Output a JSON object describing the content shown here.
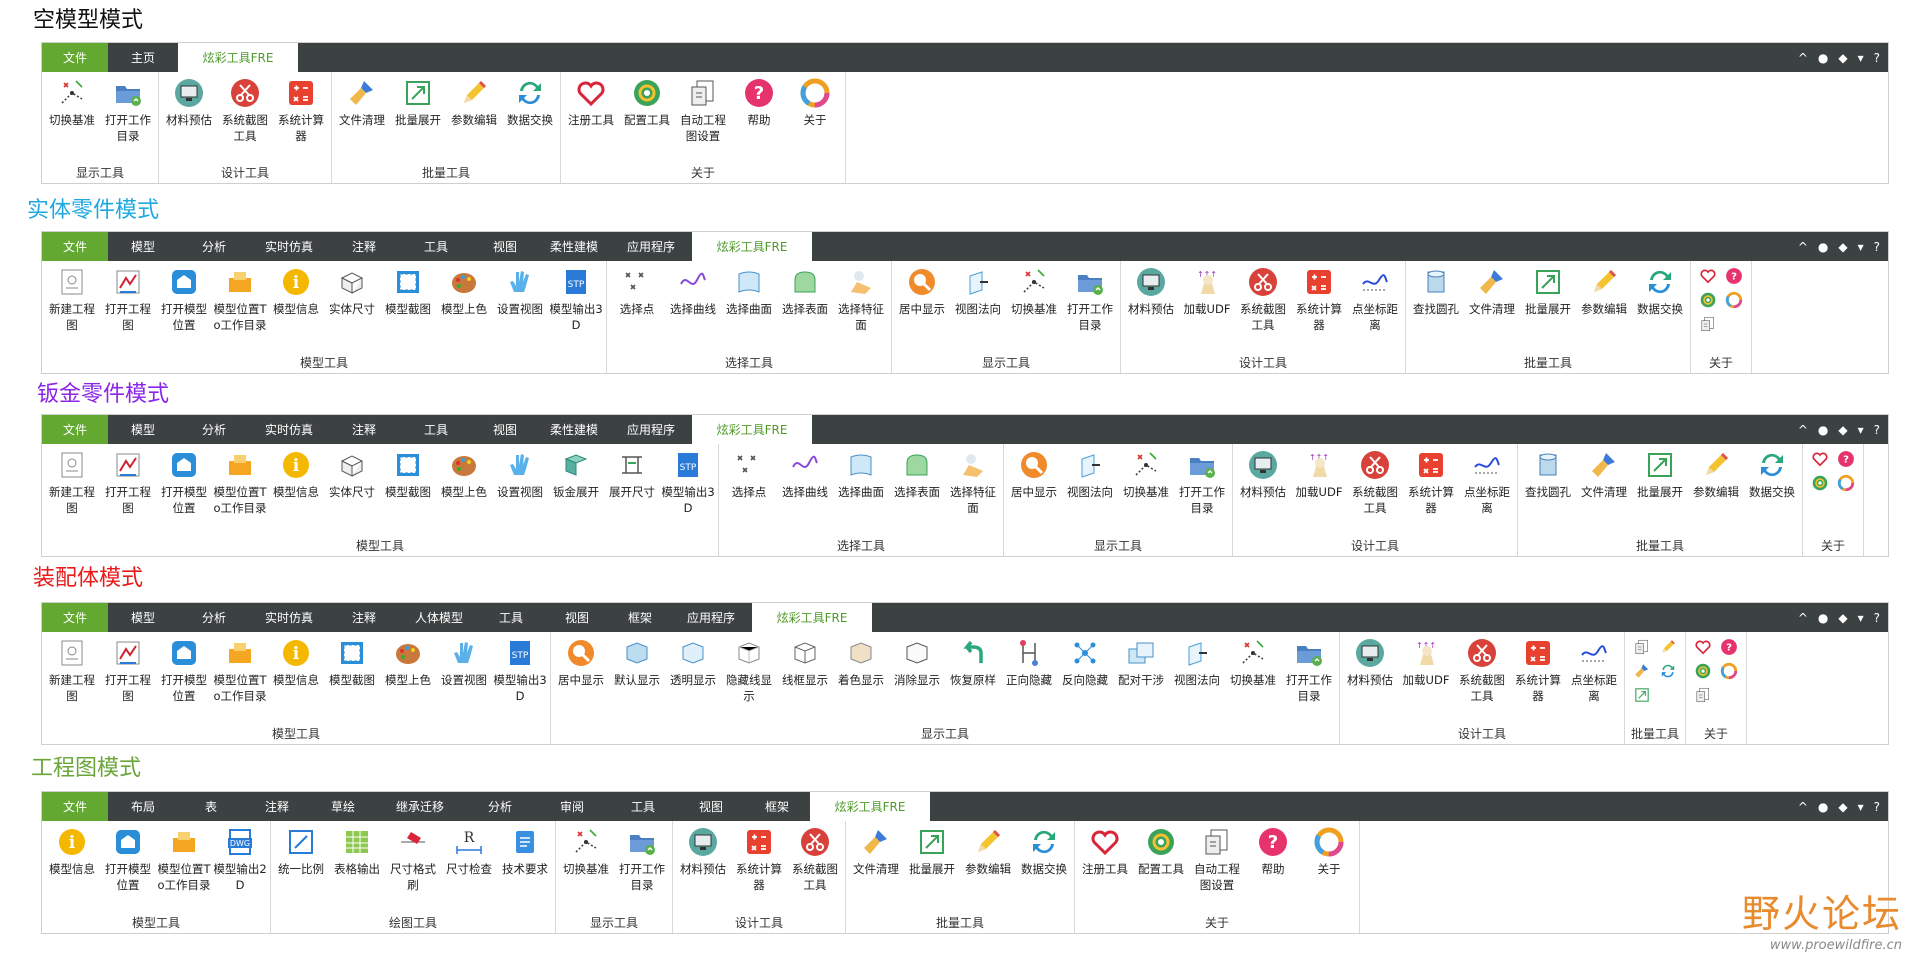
{
  "colors": {
    "file_tab": "#63a831",
    "tabbar": "#3c4142",
    "active_tab_text": "#4f9a2a",
    "title_cyan": "#1ea8e0",
    "title_purple": "#8b25e8",
    "title_red": "#e81a1a",
    "title_green": "#6aa53a"
  },
  "tb_right": {
    "up": "^",
    "user": "●",
    "cap": "◆",
    "down": "▾",
    "help": "?"
  },
  "s1": {
    "title": "空模型模式",
    "tabs": [
      "文件",
      "主页",
      "炫彩工具FRE"
    ],
    "groups": [
      {
        "label": "显示工具",
        "tools": [
          {
            "label": "切换基准",
            "icon": "axis"
          },
          {
            "label": "打开工作目录",
            "icon": "folder"
          }
        ]
      },
      {
        "label": "设计工具",
        "tools": [
          {
            "label": "材料预估",
            "icon": "monitor"
          },
          {
            "label": "系统截图工具",
            "icon": "scissors"
          },
          {
            "label": "系统计算器",
            "icon": "calc"
          }
        ]
      },
      {
        "label": "批量工具",
        "tools": [
          {
            "label": "文件清理",
            "icon": "brush"
          },
          {
            "label": "批量展开",
            "icon": "expand"
          },
          {
            "label": "参数编辑",
            "icon": "pencil"
          },
          {
            "label": "数据交换",
            "icon": "exchange"
          }
        ]
      },
      {
        "label": "关于",
        "tools": [
          {
            "label": "注册工具",
            "icon": "heart"
          },
          {
            "label": "配置工具",
            "icon": "gear"
          },
          {
            "label": "自动工程图设置",
            "icon": "drawing"
          },
          {
            "label": "帮助",
            "icon": "help"
          },
          {
            "label": "关于",
            "icon": "about"
          }
        ]
      }
    ]
  },
  "s2": {
    "title": "实体零件模式",
    "tabs": [
      "文件",
      "模型",
      "分析",
      "实时仿真",
      "注释",
      "工具",
      "视图",
      "柔性建模",
      "应用程序",
      "炫彩工具FRE"
    ],
    "groups": [
      {
        "label": "模型工具",
        "tools": [
          {
            "label": "新建工程图",
            "icon": "newdraw"
          },
          {
            "label": "打开工程图",
            "icon": "opendraw"
          },
          {
            "label": "打开模型位置",
            "icon": "openloc"
          },
          {
            "label": "模型位置To工作目录",
            "icon": "locto"
          },
          {
            "label": "模型信息",
            "icon": "info"
          },
          {
            "label": "实体尺寸",
            "icon": "box"
          },
          {
            "label": "模型截图",
            "icon": "shot"
          },
          {
            "label": "模型上色",
            "icon": "palette"
          },
          {
            "label": "设置视图",
            "icon": "hand"
          },
          {
            "label": "模型输出3D",
            "icon": "stp"
          }
        ]
      },
      {
        "label": "选择工具",
        "tools": [
          {
            "label": "选择点",
            "icon": "points"
          },
          {
            "label": "选择曲线",
            "icon": "curve"
          },
          {
            "label": "选择曲面",
            "icon": "surface"
          },
          {
            "label": "选择表面",
            "icon": "face"
          },
          {
            "label": "选择特征面",
            "icon": "feature"
          }
        ]
      },
      {
        "label": "显示工具",
        "tools": [
          {
            "label": "居中显示",
            "icon": "center"
          },
          {
            "label": "视图法向",
            "icon": "normal"
          },
          {
            "label": "切换基准",
            "icon": "axis"
          },
          {
            "label": "打开工作目录",
            "icon": "folder"
          }
        ]
      },
      {
        "label": "设计工具",
        "tools": [
          {
            "label": "材料预估",
            "icon": "monitor"
          },
          {
            "label": "加载UDF",
            "icon": "udf"
          },
          {
            "label": "系统截图工具",
            "icon": "scissors"
          },
          {
            "label": "系统计算器",
            "icon": "calc"
          },
          {
            "label": "点坐标距离",
            "icon": "ptdist"
          }
        ]
      },
      {
        "label": "批量工具",
        "tools": [
          {
            "label": "查找圆孔",
            "icon": "hole"
          },
          {
            "label": "文件清理",
            "icon": "brush"
          },
          {
            "label": "批量展开",
            "icon": "expand"
          },
          {
            "label": "参数编辑",
            "icon": "pencil"
          },
          {
            "label": "数据交换",
            "icon": "exchange"
          }
        ]
      }
    ],
    "about_label": "关于"
  },
  "s3": {
    "title": "钣金零件模式",
    "tabs": [
      "文件",
      "模型",
      "分析",
      "实时仿真",
      "注释",
      "工具",
      "视图",
      "柔性建模",
      "应用程序",
      "炫彩工具FRE"
    ],
    "groups": [
      {
        "label": "模型工具",
        "tools": [
          {
            "label": "新建工程图",
            "icon": "newdraw"
          },
          {
            "label": "打开工程图",
            "icon": "opendraw"
          },
          {
            "label": "打开模型位置",
            "icon": "openloc"
          },
          {
            "label": "模型位置To工作目录",
            "icon": "locto"
          },
          {
            "label": "模型信息",
            "icon": "info"
          },
          {
            "label": "实体尺寸",
            "icon": "box"
          },
          {
            "label": "模型截图",
            "icon": "shot"
          },
          {
            "label": "模型上色",
            "icon": "palette"
          },
          {
            "label": "设置视图",
            "icon": "hand"
          },
          {
            "label": "钣金展开",
            "icon": "sheet"
          },
          {
            "label": "展开尺寸",
            "icon": "unfold"
          },
          {
            "label": "模型输出3D",
            "icon": "stp"
          }
        ]
      },
      {
        "label": "选择工具",
        "tools": [
          {
            "label": "选择点",
            "icon": "points"
          },
          {
            "label": "选择曲线",
            "icon": "curve"
          },
          {
            "label": "选择曲面",
            "icon": "surface"
          },
          {
            "label": "选择表面",
            "icon": "face"
          },
          {
            "label": "选择特征面",
            "icon": "feature"
          }
        ]
      },
      {
        "label": "显示工具",
        "tools": [
          {
            "label": "居中显示",
            "icon": "center"
          },
          {
            "label": "视图法向",
            "icon": "normal"
          },
          {
            "label": "切换基准",
            "icon": "axis"
          },
          {
            "label": "打开工作目录",
            "icon": "folder"
          }
        ]
      },
      {
        "label": "设计工具",
        "tools": [
          {
            "label": "材料预估",
            "icon": "monitor"
          },
          {
            "label": "加载UDF",
            "icon": "udf"
          },
          {
            "label": "系统截图工具",
            "icon": "scissors"
          },
          {
            "label": "系统计算器",
            "icon": "calc"
          },
          {
            "label": "点坐标距离",
            "icon": "ptdist"
          }
        ]
      },
      {
        "label": "批量工具",
        "tools": [
          {
            "label": "查找圆孔",
            "icon": "hole"
          },
          {
            "label": "文件清理",
            "icon": "brush"
          },
          {
            "label": "批量展开",
            "icon": "expand"
          },
          {
            "label": "参数编辑",
            "icon": "pencil"
          },
          {
            "label": "数据交换",
            "icon": "exchange"
          }
        ]
      }
    ],
    "about_label": "关于"
  },
  "s4": {
    "title": "装配体模式",
    "tabs": [
      "文件",
      "模型",
      "分析",
      "实时仿真",
      "注释",
      "人体模型",
      "工具",
      "视图",
      "框架",
      "应用程序",
      "炫彩工具FRE"
    ],
    "groups": [
      {
        "label": "模型工具",
        "tools": [
          {
            "label": "新建工程图",
            "icon": "newdraw"
          },
          {
            "label": "打开工程图",
            "icon": "opendraw"
          },
          {
            "label": "打开模型位置",
            "icon": "openloc"
          },
          {
            "label": "模型位置To工作目录",
            "icon": "locto"
          },
          {
            "label": "模型信息",
            "icon": "info"
          },
          {
            "label": "模型截图",
            "icon": "shot"
          },
          {
            "label": "模型上色",
            "icon": "palette"
          },
          {
            "label": "设置视图",
            "icon": "hand"
          },
          {
            "label": "模型输出3D",
            "icon": "stp"
          }
        ]
      },
      {
        "label": "显示工具",
        "tools": [
          {
            "label": "居中显示",
            "icon": "center"
          },
          {
            "label": "默认显示",
            "icon": "cube1"
          },
          {
            "label": "透明显示",
            "icon": "cube2"
          },
          {
            "label": "隐藏线显示",
            "icon": "cube3"
          },
          {
            "label": "线框显示",
            "icon": "cube4"
          },
          {
            "label": "着色显示",
            "icon": "cube5"
          },
          {
            "label": "消除显示",
            "icon": "cube6"
          },
          {
            "label": "恢复原样",
            "icon": "undo"
          },
          {
            "label": "正向隐藏",
            "icon": "hide"
          },
          {
            "label": "反向隐藏",
            "icon": "rhide"
          },
          {
            "label": "配对干涉",
            "icon": "interf"
          },
          {
            "label": "视图法向",
            "icon": "normal"
          },
          {
            "label": "切换基准",
            "icon": "axis"
          },
          {
            "label": "打开工作目录",
            "icon": "folder"
          }
        ]
      },
      {
        "label": "设计工具",
        "tools": [
          {
            "label": "材料预估",
            "icon": "monitor"
          },
          {
            "label": "加载UDF",
            "icon": "udf"
          },
          {
            "label": "系统截图工具",
            "icon": "scissors"
          },
          {
            "label": "系统计算器",
            "icon": "calc"
          },
          {
            "label": "点坐标距离",
            "icon": "ptdist"
          }
        ]
      }
    ],
    "batch_label": "批量工具",
    "about_label": "关于"
  },
  "s5": {
    "title": "工程图模式",
    "tabs": [
      "文件",
      "布局",
      "表",
      "注释",
      "草绘",
      "继承迁移",
      "分析",
      "审阅",
      "工具",
      "视图",
      "框架",
      "炫彩工具FRE"
    ],
    "groups": [
      {
        "label": "模型工具",
        "tools": [
          {
            "label": "模型信息",
            "icon": "info"
          },
          {
            "label": "打开模型位置",
            "icon": "openloc"
          },
          {
            "label": "模型位置To工作目录",
            "icon": "locto"
          },
          {
            "label": "模型输出2D",
            "icon": "dwg"
          }
        ]
      },
      {
        "label": "绘图工具",
        "tools": [
          {
            "label": "统一比例",
            "icon": "scale"
          },
          {
            "label": "表格输出",
            "icon": "table"
          },
          {
            "label": "尺寸格式刷",
            "icon": "fmt"
          },
          {
            "label": "尺寸检查",
            "icon": "dimchk"
          },
          {
            "label": "技术要求",
            "icon": "tech"
          }
        ]
      },
      {
        "label": "显示工具",
        "tools": [
          {
            "label": "切换基准",
            "icon": "axis"
          },
          {
            "label": "打开工作目录",
            "icon": "folder"
          }
        ]
      },
      {
        "label": "设计工具",
        "tools": [
          {
            "label": "材料预估",
            "icon": "monitor"
          },
          {
            "label": "系统计算器",
            "icon": "calc"
          },
          {
            "label": "系统截图工具",
            "icon": "scissors"
          }
        ]
      },
      {
        "label": "批量工具",
        "tools": [
          {
            "label": "文件清理",
            "icon": "brush"
          },
          {
            "label": "批量展开",
            "icon": "expand"
          },
          {
            "label": "参数编辑",
            "icon": "pencil"
          },
          {
            "label": "数据交换",
            "icon": "exchange"
          }
        ]
      },
      {
        "label": "关于",
        "tools": [
          {
            "label": "注册工具",
            "icon": "heart"
          },
          {
            "label": "配置工具",
            "icon": "gear"
          },
          {
            "label": "自动工程图设置",
            "icon": "drawing"
          },
          {
            "label": "帮助",
            "icon": "help"
          },
          {
            "label": "关于",
            "icon": "about"
          }
        ]
      }
    ]
  },
  "watermark": {
    "big": "野火论坛",
    "small": "www.proewildfire.cn"
  }
}
